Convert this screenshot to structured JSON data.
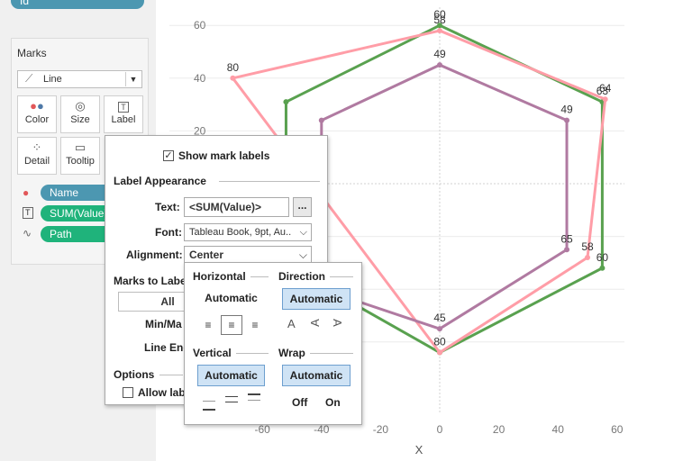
{
  "left": {
    "top_pill_label": "Id",
    "marks_title": "Marks",
    "mark_type": "Line",
    "buttons": [
      {
        "label": "Color",
        "icon": "color-dots-icon"
      },
      {
        "label": "Size",
        "icon": "size-icon"
      },
      {
        "label": "Label",
        "icon": "label-icon"
      },
      {
        "label": "Detail",
        "icon": "detail-icon"
      },
      {
        "label": "Tooltip",
        "icon": "tooltip-icon"
      }
    ],
    "fields": [
      {
        "label": "Name",
        "color": "#4c97b1"
      },
      {
        "label": "SUM(Value)",
        "color": "#1fb37b"
      },
      {
        "label": "Path",
        "color": "#1fb37b"
      }
    ]
  },
  "label_panel": {
    "show_mark_labels": "Show mark labels",
    "show_checked": true,
    "section": "Label Appearance",
    "text_label": "Text:",
    "text_value": "<SUM(Value)>",
    "more_button": "...",
    "font_label": "Font:",
    "font_value": "Tableau Book, 9pt, Au..",
    "alignment_label": "Alignment:",
    "alignment_value": "Center",
    "marks_to_label": "Marks to Labe",
    "all_button": "All",
    "minmax": "Min/Ma",
    "line_ends": "Line End",
    "options": "Options",
    "allow_labels": "Allow lab"
  },
  "align_panel": {
    "horizontal": "Horizontal",
    "direction": "Direction",
    "h_automatic": "Automatic",
    "dir_automatic": "Automatic",
    "dir_glyph": "A",
    "vertical": "Vertical",
    "wrap": "Wrap",
    "v_automatic": "Automatic",
    "wrap_automatic": "Automatic",
    "off": "Off",
    "on": "On"
  },
  "chart_data": {
    "type": "line",
    "xlabel": "X",
    "x_ticks": [
      "-60",
      "-40",
      "-20",
      "0",
      "20",
      "40",
      "60"
    ],
    "y_ticks": [
      "60",
      "40",
      "20"
    ],
    "xlim": [
      -60,
      60
    ],
    "series": [
      {
        "color": "#59a14f",
        "points": [
          [
            0,
            60
          ],
          [
            55,
            31
          ],
          [
            55,
            -32
          ],
          [
            0,
            -64
          ],
          [
            -52,
            -31
          ],
          [
            -52,
            31
          ]
        ],
        "labels": [
          "60",
          "63",
          "60"
        ]
      },
      {
        "color": "#ff9da7",
        "points": [
          [
            0,
            58
          ],
          [
            56,
            32
          ],
          [
            50,
            -28
          ],
          [
            0,
            -64
          ],
          [
            -70,
            40
          ]
        ],
        "labels": [
          "58",
          "64",
          "58",
          "80",
          "80"
        ]
      },
      {
        "color": "#b07aa1",
        "points": [
          [
            0,
            45
          ],
          [
            43,
            24
          ],
          [
            43,
            -25
          ],
          [
            0,
            -55
          ],
          [
            -40,
            -40
          ],
          [
            -40,
            24
          ]
        ],
        "labels": [
          "49",
          "49",
          "65",
          "45"
        ]
      }
    ]
  }
}
